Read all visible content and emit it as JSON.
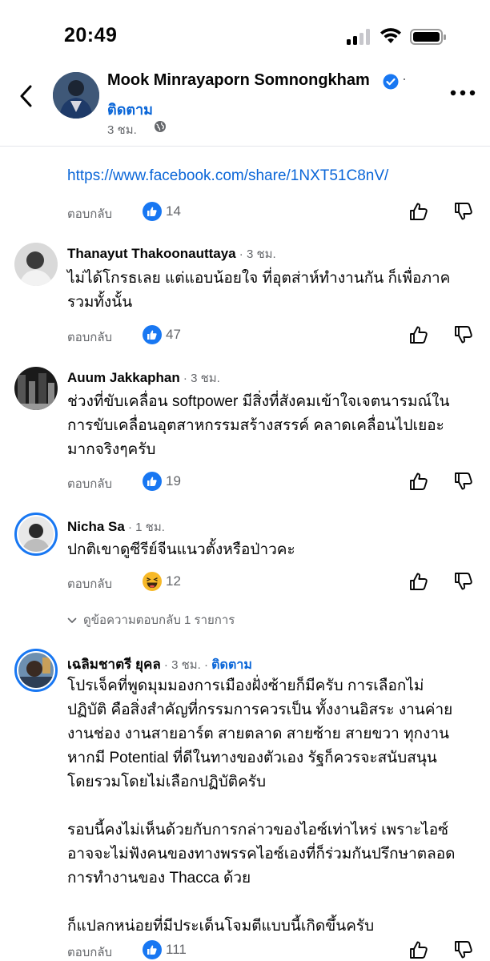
{
  "status_bar": {
    "time": "20:49"
  },
  "header": {
    "author": "Mook Minrayaporn Somnongkham",
    "follow_label": "ติดตาม",
    "post_time": "3 ชม.",
    "dot": "·"
  },
  "first_comment": {
    "link": "https://www.facebook.com/share/1NXT51C8nV/",
    "reply_label": "ตอบกลับ",
    "reaction_count": "14"
  },
  "comments": [
    {
      "name": "Thanayut Thakoonauttaya",
      "time": " · 3 ชม.",
      "text_lines": [
        "ไม่ได้โกรธเลย แต่แอบน้อยใจ ที่อุตส่าห์ทำงานกัน ก็เพื่อภาค",
        "รวมทั้งนั้น"
      ],
      "reply_label": "ตอบกลับ",
      "reaction_count": "47"
    },
    {
      "name": "Auum Jakkaphan",
      "time": " · 3 ชม.",
      "text_lines": [
        "ช่วงที่ขับเคลื่อน softpower มีสิ่งที่สังคมเข้าใจเจตนารมณ์ใน",
        "การขับเคลื่อนอุตสาหกรรมสร้างสรรค์ คลาดเคลื่อนไปเยอะ",
        "มากจริงๆครับ"
      ],
      "reply_label": "ตอบกลับ",
      "reaction_count": "19"
    },
    {
      "name": "Nicha Sa",
      "time": " · 1 ชม.",
      "text_lines": [
        "ปกติเขาดูซีรีย์จีนแนวตั้งหรือป่าวคะ"
      ],
      "reply_label": "ตอบกลับ",
      "reaction_count": "12",
      "view_replies": "ดูข้อความตอบกลับ 1 รายการ"
    },
    {
      "name": "เฉลิมชาตรี ยุคล",
      "time": " · 3 ชม. · ",
      "follow": "ติดตาม",
      "text_lines": [
        "โปรเจ็คที่พูดมุมมองการเมืองฝั่งซ้ายก็มีครับ การเลือกไม่",
        "ปฏิบัติ คือสิ่งสำคัญที่กรรมการควรเป็น ทั้งงานอิสระ งานค่าย",
        "งานช่อง งานสายอาร์ต สายตลาด สายซ้าย สายขวา ทุกงาน",
        "หากมี Potential ที่ดีในทางของตัวเอง รัฐก็ควรจะสนับสนุน",
        "โดยรวมโดยไม่เลือกปฏิบัติครับ",
        "",
        "รอบนี้คงไม่เห็นด้วยกับการกล่าวของไอซ์เท่าไหร่ เพราะไอซ์",
        "อาจจะไม่ฟังคนของทางพรรคไอซ์เองที่ก็ร่วมกันปรึกษาตลอด",
        "การทำงานของ Thacca ด้วย",
        "",
        "ก็แปลกหน่อยที่มีประเด็นโจมตีแบบนี้เกิดขึ้นครับ"
      ],
      "reply_label": "ตอบกลับ",
      "reaction_count": "111"
    }
  ],
  "colors": {
    "link": "#0a66d8",
    "like_blue": "#1877f2",
    "secondary_text": "#65676b"
  },
  "icons": [
    "back-chevron-icon",
    "verified-badge-icon",
    "globe-icon",
    "more-icon",
    "like-reaction-icon",
    "haha-reaction-icon",
    "thumbs-up-icon",
    "thumbs-down-icon"
  ]
}
